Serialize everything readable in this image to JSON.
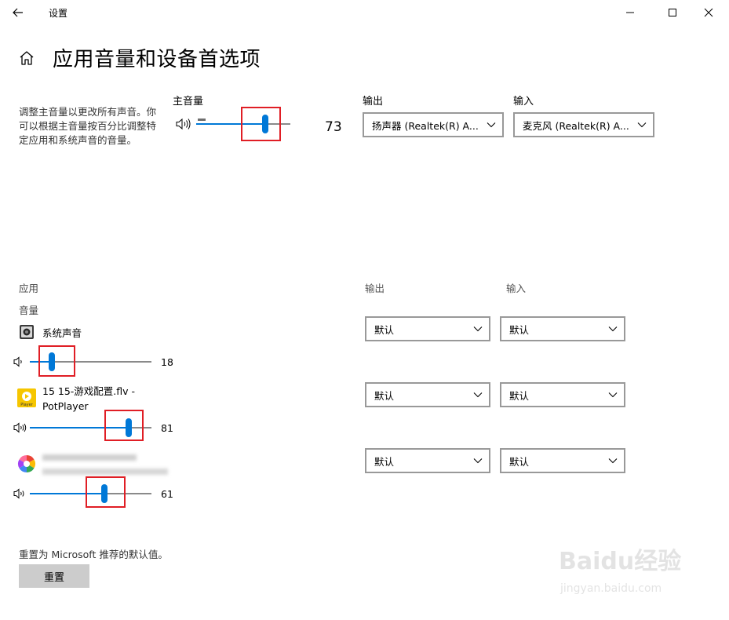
{
  "window": {
    "title": "设置"
  },
  "page": {
    "title": "应用音量和设备首选项",
    "description": "调整主音量以更改所有声音。你可以根据主音量按百分比调整特定应用和系统声音的音量。"
  },
  "master": {
    "label": "主音量",
    "volume": 73,
    "volume_text": "73",
    "output_label": "输出",
    "output_value": "扬声器 (Realtek(R) A...",
    "input_label": "输入",
    "input_value": "麦克风 (Realtek(R) A..."
  },
  "apps_section": {
    "label": "应用",
    "volume_label": "音量",
    "output_header": "输出",
    "input_header": "输入",
    "apps": [
      {
        "name": "系统声音",
        "icon": "system-sounds-icon",
        "volume": 18,
        "volume_text": "18",
        "output": "默认",
        "input": "默认"
      },
      {
        "name": "15 15-游戏配置.flv - PotPlayer",
        "icon": "potplayer-icon",
        "volume": 81,
        "volume_text": "81",
        "output": "默认",
        "input": "默认"
      },
      {
        "name": "",
        "icon": "color-wheel-app-icon",
        "volume": 61,
        "volume_text": "61",
        "output": "默认",
        "input": "默认"
      }
    ]
  },
  "reset": {
    "text": "重置为 Microsoft 推荐的默认值。",
    "button_label": "重置"
  },
  "watermark": {
    "brand": "Baidu经验",
    "url": "jingyan.baidu.com"
  },
  "colors": {
    "accent": "#0078d7",
    "highlight": "#e01e25"
  }
}
